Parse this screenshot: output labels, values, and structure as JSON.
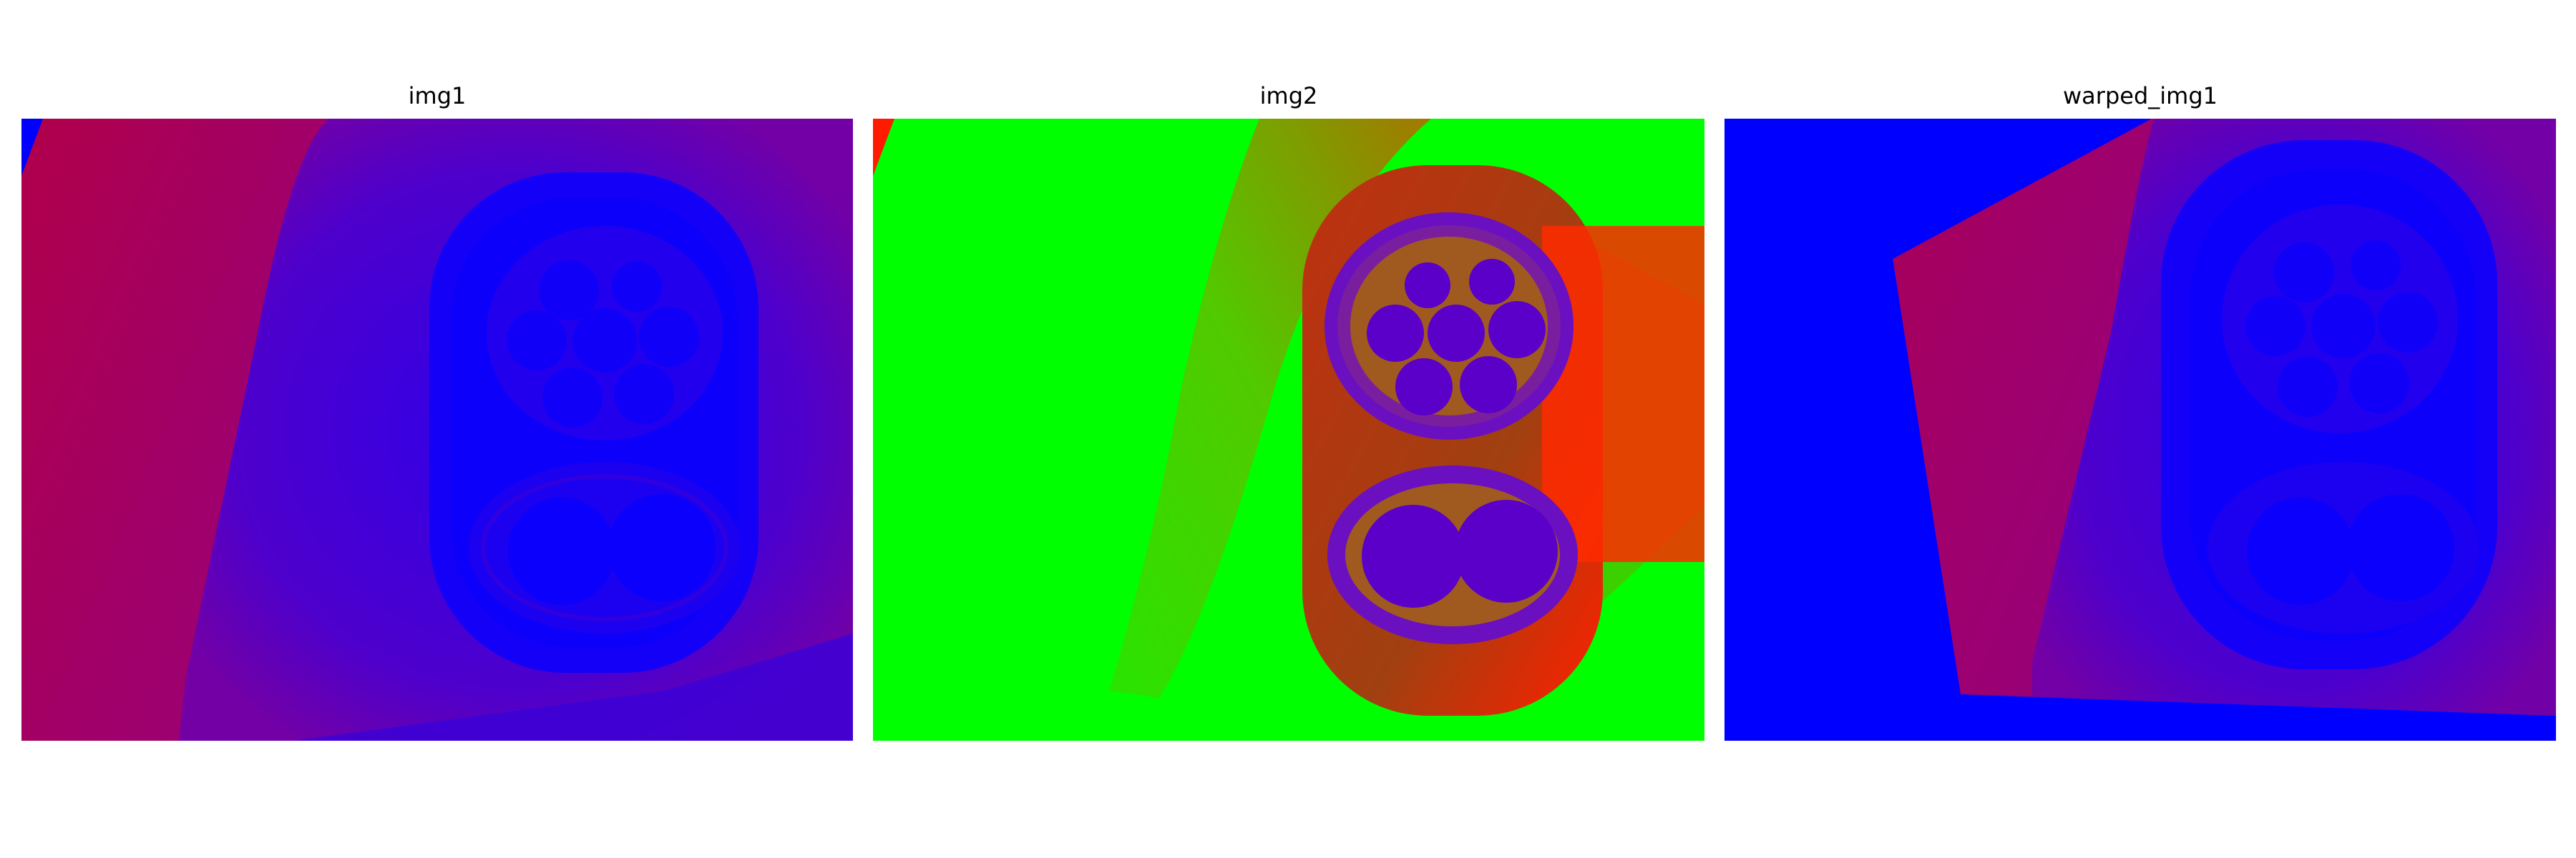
{
  "figure": {
    "panels": [
      {
        "title": "img1"
      },
      {
        "title": "img2"
      },
      {
        "title": "warped_img1"
      }
    ]
  },
  "colors": {
    "blue": "#0000ff",
    "magenta_red": "#b0004a",
    "green": "#00ff00",
    "red": "#ff1a00",
    "purple": "#5a00c8"
  }
}
